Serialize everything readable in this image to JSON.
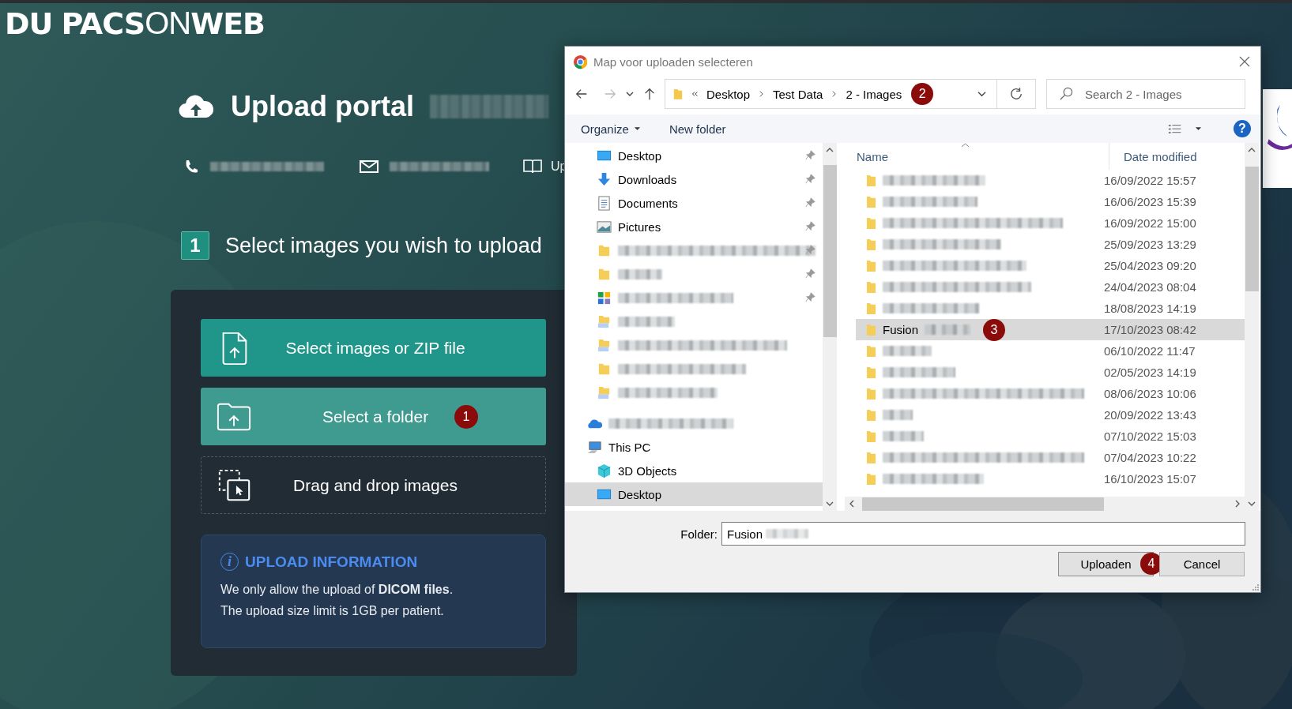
{
  "portal": {
    "logo_mark": "DU",
    "logo_parts": [
      "PACS",
      "ON",
      "WEB"
    ],
    "title": "Upload portal",
    "manual_link": "Up"
  },
  "step": {
    "number": "1",
    "title": "Select images you wish to upload"
  },
  "upload_options": [
    {
      "kind": "file",
      "label": "Select images or ZIP file",
      "hovered": false
    },
    {
      "kind": "folder",
      "label": "Select a folder",
      "hovered": true,
      "badge": "1"
    },
    {
      "kind": "dragdrop",
      "label": "Drag and drop images",
      "hovered": false
    }
  ],
  "upload_information": {
    "icon": "i",
    "title": "UPLOAD INFORMATION",
    "lines": [
      "We only allow the upload of **DICOM files**.",
      "The upload size limit is 1GB per patient."
    ]
  },
  "dialog": {
    "title": "Map voor uploaden selecteren",
    "breadcrumbs": [
      "Desktop",
      "Test Data",
      "2 - Images"
    ],
    "address_badge": "2",
    "search": {
      "placeholder": "Search 2 - Images"
    },
    "toolbar": {
      "organize": "Organize",
      "new_folder": "New folder",
      "help": "?"
    },
    "quick_access": [
      {
        "kind": "desktop",
        "label": "Desktop",
        "pinned": true,
        "selected": false
      },
      {
        "kind": "downloads",
        "label": "Downloads",
        "pinned": true,
        "selected": false
      },
      {
        "kind": "documents",
        "label": "Documents",
        "pinned": true,
        "selected": false
      },
      {
        "kind": "pictures",
        "label": "Pictures",
        "pinned": true,
        "selected": false
      },
      {
        "kind": "folder",
        "pinned": true,
        "selected": false
      },
      {
        "kind": "folder",
        "pinned": true,
        "selected": false
      },
      {
        "kind": "drive",
        "pinned": true,
        "selected": false
      },
      {
        "kind": "synced",
        "pinned": false,
        "selected": false
      },
      {
        "kind": "synced",
        "pinned": false,
        "selected": false
      },
      {
        "kind": "folder",
        "pinned": false,
        "selected": false
      },
      {
        "kind": "synced",
        "pinned": false,
        "selected": false
      }
    ],
    "locations": [
      {
        "kind": "onedrive",
        "selected": false
      },
      {
        "kind": "pc",
        "label": "This PC",
        "selected": false,
        "children": [
          {
            "kind": "objects3d",
            "label": "3D Objects",
            "selected": false
          },
          {
            "kind": "desktop",
            "label": "Desktop",
            "selected": true
          }
        ]
      }
    ],
    "columns": [
      "Name",
      "Date modified"
    ],
    "files": [
      {
        "date": "16/09/2022 15:57",
        "selected": false
      },
      {
        "date": "16/06/2023 15:39",
        "selected": false
      },
      {
        "date": "16/09/2022 15:00",
        "selected": false
      },
      {
        "date": "25/09/2023 13:29",
        "selected": false
      },
      {
        "date": "25/04/2023 09:20",
        "selected": false
      },
      {
        "date": "24/04/2023 08:04",
        "selected": false
      },
      {
        "date": "18/08/2023 14:19",
        "selected": false
      },
      {
        "name": "Fusion",
        "date": "17/10/2023 08:42",
        "selected": true,
        "badge": "3"
      },
      {
        "date": "06/10/2022 11:47",
        "selected": false
      },
      {
        "date": "02/05/2023 14:19",
        "selected": false
      },
      {
        "date": "08/06/2023 10:06",
        "selected": false
      },
      {
        "date": "20/09/2022 13:43",
        "selected": false
      },
      {
        "date": "07/10/2022 15:03",
        "selected": false
      },
      {
        "date": "07/04/2023 10:22",
        "selected": false
      },
      {
        "date": "16/10/2023 15:07",
        "selected": false
      }
    ],
    "folder_field": {
      "label": "Folder:",
      "value": "Fusion"
    },
    "buttons": [
      {
        "kind": "primary",
        "label": "Uploaden",
        "badge": "4"
      },
      {
        "kind": "cancel",
        "label": "Cancel"
      }
    ]
  }
}
